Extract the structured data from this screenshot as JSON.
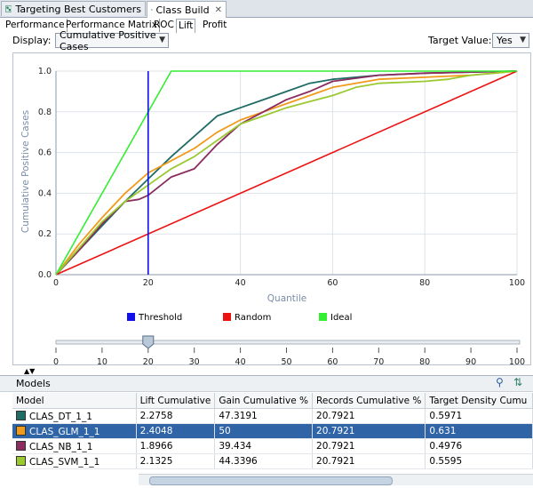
{
  "doc_tabs": [
    {
      "label": "Targeting Best Customers",
      "icon": "workflow-icon",
      "active": false
    },
    {
      "label": "Class Build",
      "icon": "workflow-icon",
      "active": true
    }
  ],
  "subtabs": [
    "Performance",
    "Performance Matrix",
    "ROC",
    "Lift",
    "Profit"
  ],
  "active_subtab": "Lift",
  "toolbar": {
    "display_label": "Display:",
    "display_value": "Cumulative Positive Cases",
    "target_label": "Target Value:",
    "target_value": "Yes"
  },
  "chart_data": {
    "type": "line",
    "xlabel": "Quantile",
    "ylabel": "Cumulative Positive Cases",
    "xlim": [
      0,
      100
    ],
    "ylim": [
      0,
      1.0
    ],
    "x_ticks": [
      "0",
      "20",
      "40",
      "60",
      "80",
      "100"
    ],
    "y_ticks": [
      "0.0",
      "0.2",
      "0.4",
      "0.6",
      "0.8",
      "1.0"
    ],
    "grid": true,
    "legend_position": "bottom",
    "threshold": 20,
    "series": [
      {
        "name": "Threshold",
        "color": "#1010ee",
        "x": [
          20,
          20
        ],
        "y": [
          0,
          1.0
        ]
      },
      {
        "name": "Random",
        "color": "#ee1111",
        "x": [
          0,
          100
        ],
        "y": [
          0,
          1.0
        ]
      },
      {
        "name": "Ideal",
        "color": "#33ee33",
        "x": [
          0,
          25,
          100
        ],
        "y": [
          0,
          1.0,
          1.0
        ]
      },
      {
        "color": "#1f6b66",
        "x": [
          0,
          5,
          10,
          15,
          20,
          25,
          30,
          35,
          40,
          45,
          50,
          55,
          60,
          65,
          70,
          80,
          100
        ],
        "y": [
          0,
          0.12,
          0.24,
          0.36,
          0.47,
          0.58,
          0.68,
          0.78,
          0.82,
          0.86,
          0.9,
          0.94,
          0.96,
          0.97,
          0.98,
          0.99,
          1.0
        ]
      },
      {
        "color": "#f09a1c",
        "x": [
          0,
          5,
          10,
          15,
          20,
          25,
          30,
          35,
          40,
          45,
          50,
          55,
          60,
          65,
          70,
          80,
          90,
          100
        ],
        "y": [
          0,
          0.15,
          0.28,
          0.4,
          0.5,
          0.56,
          0.62,
          0.7,
          0.76,
          0.8,
          0.84,
          0.88,
          0.92,
          0.94,
          0.96,
          0.97,
          0.98,
          1.0
        ]
      },
      {
        "color": "#8b2d5e",
        "x": [
          0,
          5,
          10,
          15,
          18,
          20,
          25,
          30,
          35,
          40,
          45,
          50,
          55,
          60,
          70,
          80,
          100
        ],
        "y": [
          0,
          0.12,
          0.25,
          0.36,
          0.37,
          0.39,
          0.48,
          0.52,
          0.64,
          0.74,
          0.8,
          0.86,
          0.9,
          0.95,
          0.98,
          0.99,
          1.0
        ]
      },
      {
        "color": "#9ac930",
        "x": [
          0,
          5,
          10,
          15,
          20,
          25,
          30,
          35,
          40,
          45,
          50,
          55,
          60,
          65,
          70,
          80,
          85,
          90,
          100
        ],
        "y": [
          0,
          0.13,
          0.26,
          0.36,
          0.44,
          0.52,
          0.58,
          0.66,
          0.74,
          0.78,
          0.82,
          0.85,
          0.88,
          0.92,
          0.94,
          0.95,
          0.96,
          0.98,
          1.0
        ]
      }
    ]
  },
  "slider": {
    "value": 20,
    "ticks": [
      "0",
      "10",
      "20",
      "30",
      "40",
      "50",
      "60",
      "70",
      "80",
      "90",
      "100"
    ]
  },
  "models_panel": {
    "title": "Models",
    "columns": [
      "Model",
      "Lift Cumulative",
      "Gain Cumulative %",
      "Records Cumulative %",
      "Target Density Cumu"
    ],
    "rows": [
      {
        "color": "#1f6b66",
        "cells": [
          "CLAS_DT_1_1",
          "2.2758",
          "47.3191",
          "20.7921",
          "0.5971"
        ]
      },
      {
        "color": "#f09a1c",
        "cells": [
          "CLAS_GLM_1_1",
          "2.4048",
          "50",
          "20.7921",
          "0.631"
        ],
        "selected": true
      },
      {
        "color": "#8b2d5e",
        "cells": [
          "CLAS_NB_1_1",
          "1.8966",
          "39.434",
          "20.7921",
          "0.4976"
        ]
      },
      {
        "color": "#9ac930",
        "cells": [
          "CLAS_SVM_1_1",
          "2.1325",
          "44.3396",
          "20.7921",
          "0.5595"
        ]
      }
    ]
  }
}
